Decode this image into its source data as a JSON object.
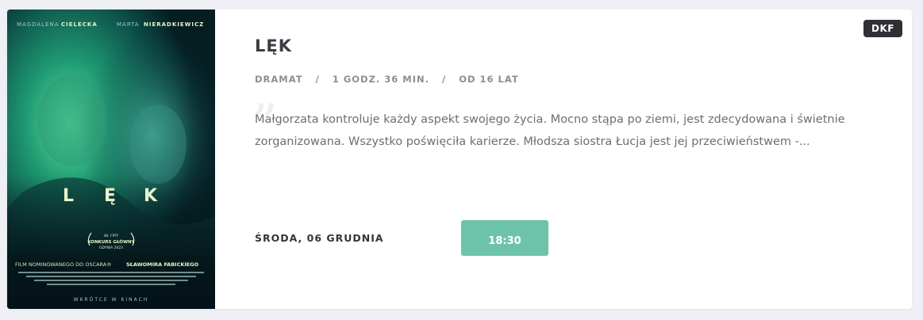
{
  "badge": "DKF",
  "film": {
    "title": "LĘK",
    "genre": "DRAMAT",
    "duration": "1 GODZ. 36 MIN.",
    "age": "OD 16 LAT",
    "separator": "/",
    "quote_mark": "”",
    "description": "Małgorzata kontroluje każdy aspekt swojego życia. Mocno stąpa po ziemi, jest zdecydowana i świetnie zorganizowana. Wszystko poświęciła karierze. Młodsza siostra Łucja jest jej przeciwieństwem -..."
  },
  "screening": {
    "date": "ŚRODA, 06 GRUDNIA",
    "time": "18:30"
  },
  "poster": {
    "actor1_first": "MAGDALENA",
    "actor1_last": "CIELECKA",
    "actor2_first": "MARTA",
    "actor2_last": "NIERADKIEWICZ",
    "title_l": "L",
    "title_e": "Ę",
    "title_k": "K",
    "award_top": "48. FPFF",
    "award_main": "KONKURS GŁÓWNY",
    "award_bottom": "GDYNIA 2023",
    "tagline_left": "FILM NOMINOWANEGO DO OSCARA®",
    "tagline_right": "SŁAWOMIRA FABICKIEGO",
    "footer": "WKRÓTCE W KINACH",
    "colors": {
      "background": "#062a2c",
      "glow": "#3fbf8a",
      "accent_text": "#e8f4c8"
    }
  }
}
